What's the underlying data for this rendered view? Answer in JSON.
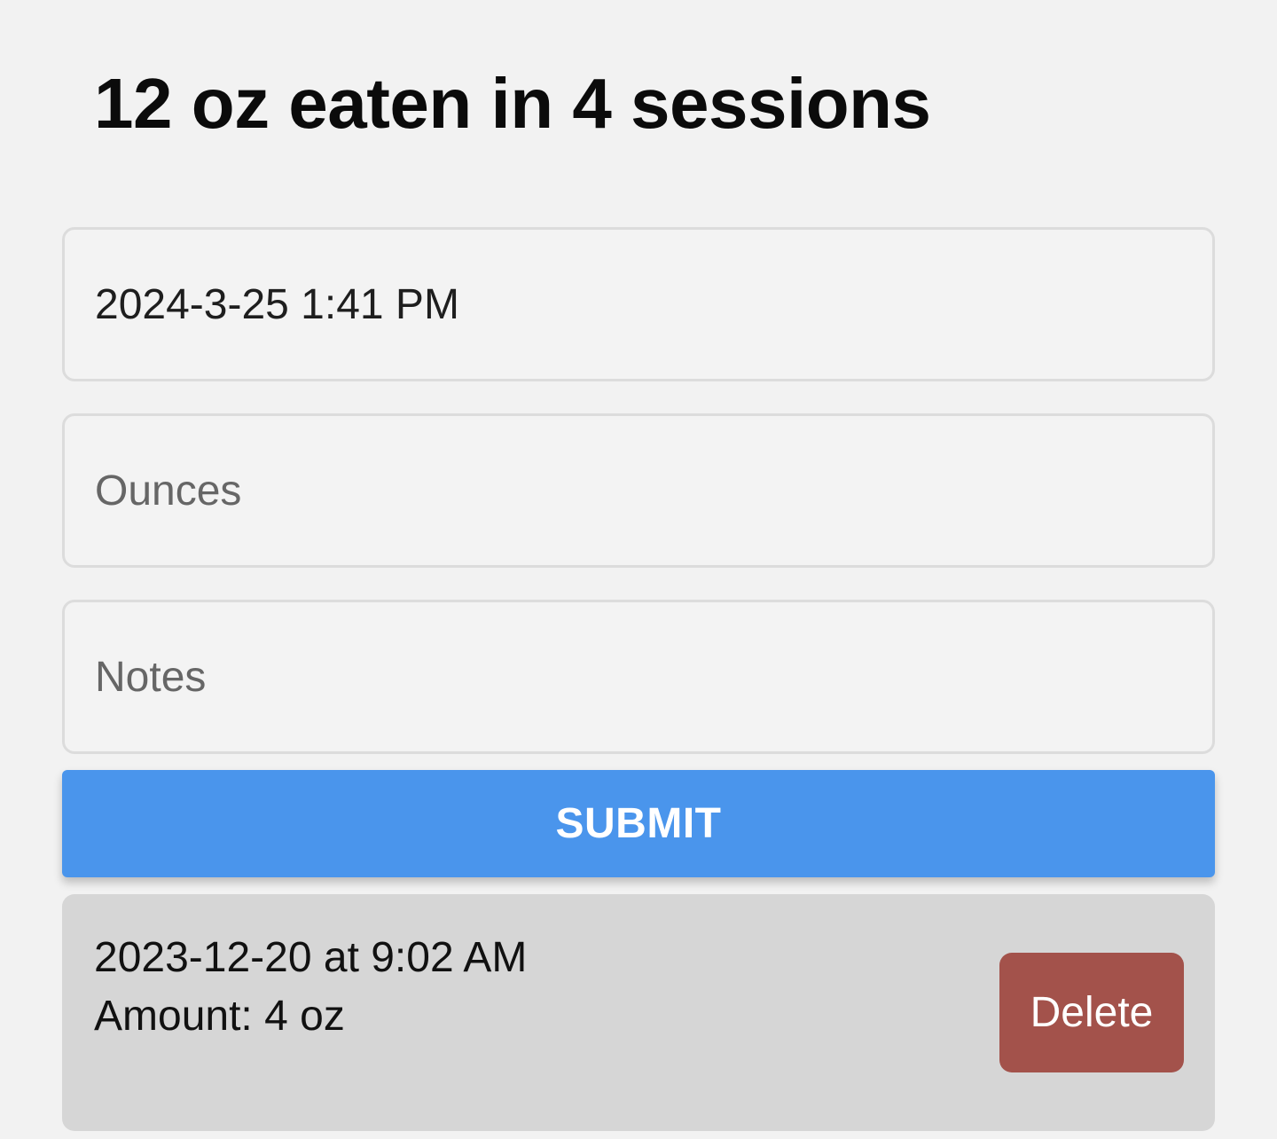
{
  "header": {
    "title": "12 oz eaten in 4 sessions"
  },
  "form": {
    "time_value": "2024-3-25 1:41 PM",
    "ounces_placeholder": "Ounces",
    "notes_placeholder": "Notes",
    "submit_label": "SUBMIT"
  },
  "entries": [
    {
      "date": "2023-12-20 at 9:02 AM",
      "amount": "Amount: 4 oz",
      "delete_label": "Delete"
    }
  ],
  "colors": {
    "background": "#f2f2f2",
    "submit": "#4a95ec",
    "delete": "#a3524b",
    "entry_card": "#d6d6d6"
  }
}
